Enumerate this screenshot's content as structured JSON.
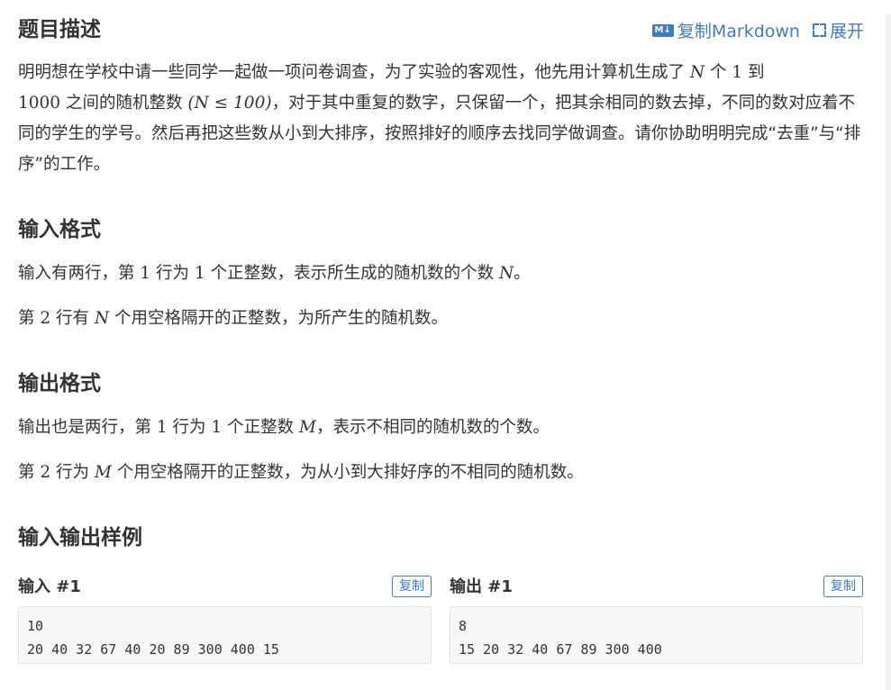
{
  "colors": {
    "accent": "#3f7bbd",
    "text": "#333333",
    "code_bg": "#f7f7f7"
  },
  "header": {
    "title": "题目描述",
    "copy_markdown_icon": "M↓",
    "copy_markdown_label": "复制Markdown",
    "expand_label": "展开"
  },
  "description": {
    "t1": "明明想在学校中请一些同学一起做一项问卷调查，为了实验的客观性，他先用计算机生成了 ",
    "m1": "N",
    "t2": " 个 ",
    "m2": "1",
    "t3": " 到",
    "m3": "1000",
    "t4": " 之间的随机整数 ",
    "m4": "(N ≤ 100)",
    "t5": "，对于其中重复的数字，只保留一个，把其余相同的数去掉，不同的数对应着不同的学生的学号。然后再把这些数从小到大排序，按照排好的顺序去找同学做调查。请你协助明明完成“去重”与“排序”的工作。"
  },
  "input_format": {
    "title": "输入格式",
    "p1": {
      "t1": "输入有两行，第 ",
      "m1": "1",
      "t2": " 行为 ",
      "m2": "1",
      "t3": " 个正整数，表示所生成的随机数的个数 ",
      "m3": "N",
      "t4": "。"
    },
    "p2": {
      "t1": "第 ",
      "m1": "2",
      "t2": " 行有 ",
      "m2": "N",
      "t3": " 个用空格隔开的正整数，为所产生的随机数。"
    }
  },
  "output_format": {
    "title": "输出格式",
    "p1": {
      "t1": "输出也是两行，第 ",
      "m1": "1",
      "t2": " 行为 ",
      "m2": "1",
      "t3": " 个正整数 ",
      "m3": "M",
      "t4": "，表示不相同的随机数的个数。"
    },
    "p2": {
      "t1": "第 ",
      "m1": "2",
      "t2": " 行为 ",
      "m2": "M",
      "t3": " 个用空格隔开的正整数，为从小到大排好序的不相同的随机数。"
    }
  },
  "samples": {
    "title": "输入输出样例",
    "input": {
      "title": "输入 #1",
      "copy_label": "复制",
      "content": "10\n20 40 32 67 40 20 89 300 400 15"
    },
    "output": {
      "title": "输出 #1",
      "copy_label": "复制",
      "content": "8\n15 20 32 40 67 89 300 400"
    }
  }
}
